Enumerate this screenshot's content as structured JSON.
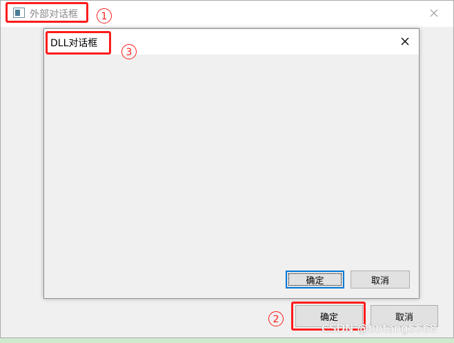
{
  "outer": {
    "title": "外部对话框",
    "ok_label": "确定",
    "cancel_label": "取消"
  },
  "inner": {
    "title": "DLL对话框",
    "ok_label": "确定",
    "cancel_label": "取消"
  },
  "annotations": {
    "label1": "1",
    "label2": "2",
    "label3": "3",
    "color": "#ff1a1a"
  },
  "watermark": "CSDN @bbtang5568",
  "icons": {
    "close": "close-icon",
    "app": "window-app-icon"
  }
}
